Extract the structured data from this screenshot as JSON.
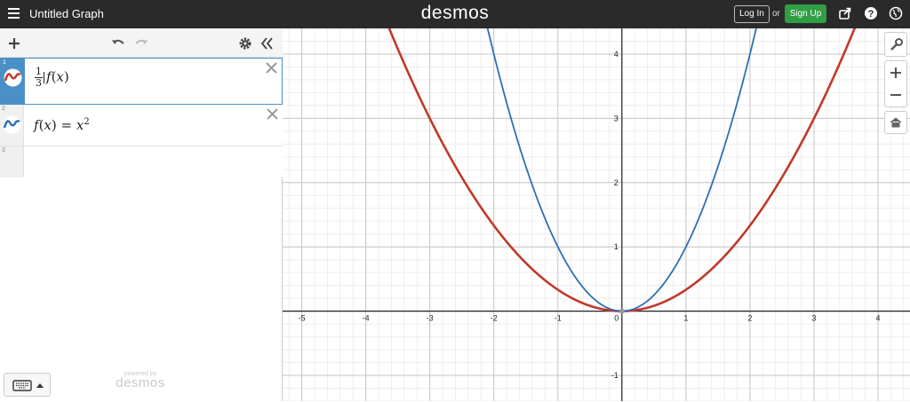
{
  "header": {
    "title": "Untitled Graph",
    "brand": "desmos",
    "login_label": "Log In",
    "or_label": "or",
    "signup_label": "Sign Up",
    "signup_color": "#2f9e44"
  },
  "toolbar": {
    "icons": [
      "add-icon",
      "undo-icon",
      "redo-icon",
      "settings-gear-icon",
      "collapse-panel-icon"
    ]
  },
  "expressions": [
    {
      "index": "1",
      "color": "#c0392b",
      "numerator": "1",
      "denominator": "3",
      "func": "f",
      "arg": "x"
    },
    {
      "index": "2",
      "color": "#2d70b3",
      "lhs_func": "f",
      "lhs_arg": "x",
      "equals": "=",
      "base": "x",
      "exponent": "2"
    },
    {
      "index": "3"
    }
  ],
  "footer": {
    "powered_by": "powered by",
    "brand": "desmos"
  },
  "graph_controls": [
    "wrench-icon",
    "zoom-in-icon",
    "zoom-out-icon",
    "home-icon"
  ],
  "chart_data": {
    "type": "line",
    "xlim": [
      -5.3,
      4.5
    ],
    "ylim": [
      -1.4,
      4.4
    ],
    "grid": true,
    "x_ticks": [
      "-5",
      "-4",
      "-3",
      "-2",
      "-1",
      "0",
      "1",
      "2",
      "3",
      "4"
    ],
    "y_ticks": [
      "-1",
      "1",
      "2",
      "3",
      "4"
    ],
    "series": [
      {
        "expression": "(1/3)f(x)",
        "color": "#c0392b",
        "x": [
          -3.5,
          -3,
          -2,
          -1,
          0,
          1,
          2,
          3,
          3.5
        ],
        "y": [
          4.08,
          3,
          1.33,
          0.33,
          0,
          0.33,
          1.33,
          3,
          4.08
        ]
      },
      {
        "expression": "f(x)=x^2",
        "color": "#2d70b3",
        "x": [
          -2,
          -1,
          0,
          1,
          2
        ],
        "y": [
          4,
          1,
          0,
          1,
          4
        ]
      }
    ]
  }
}
